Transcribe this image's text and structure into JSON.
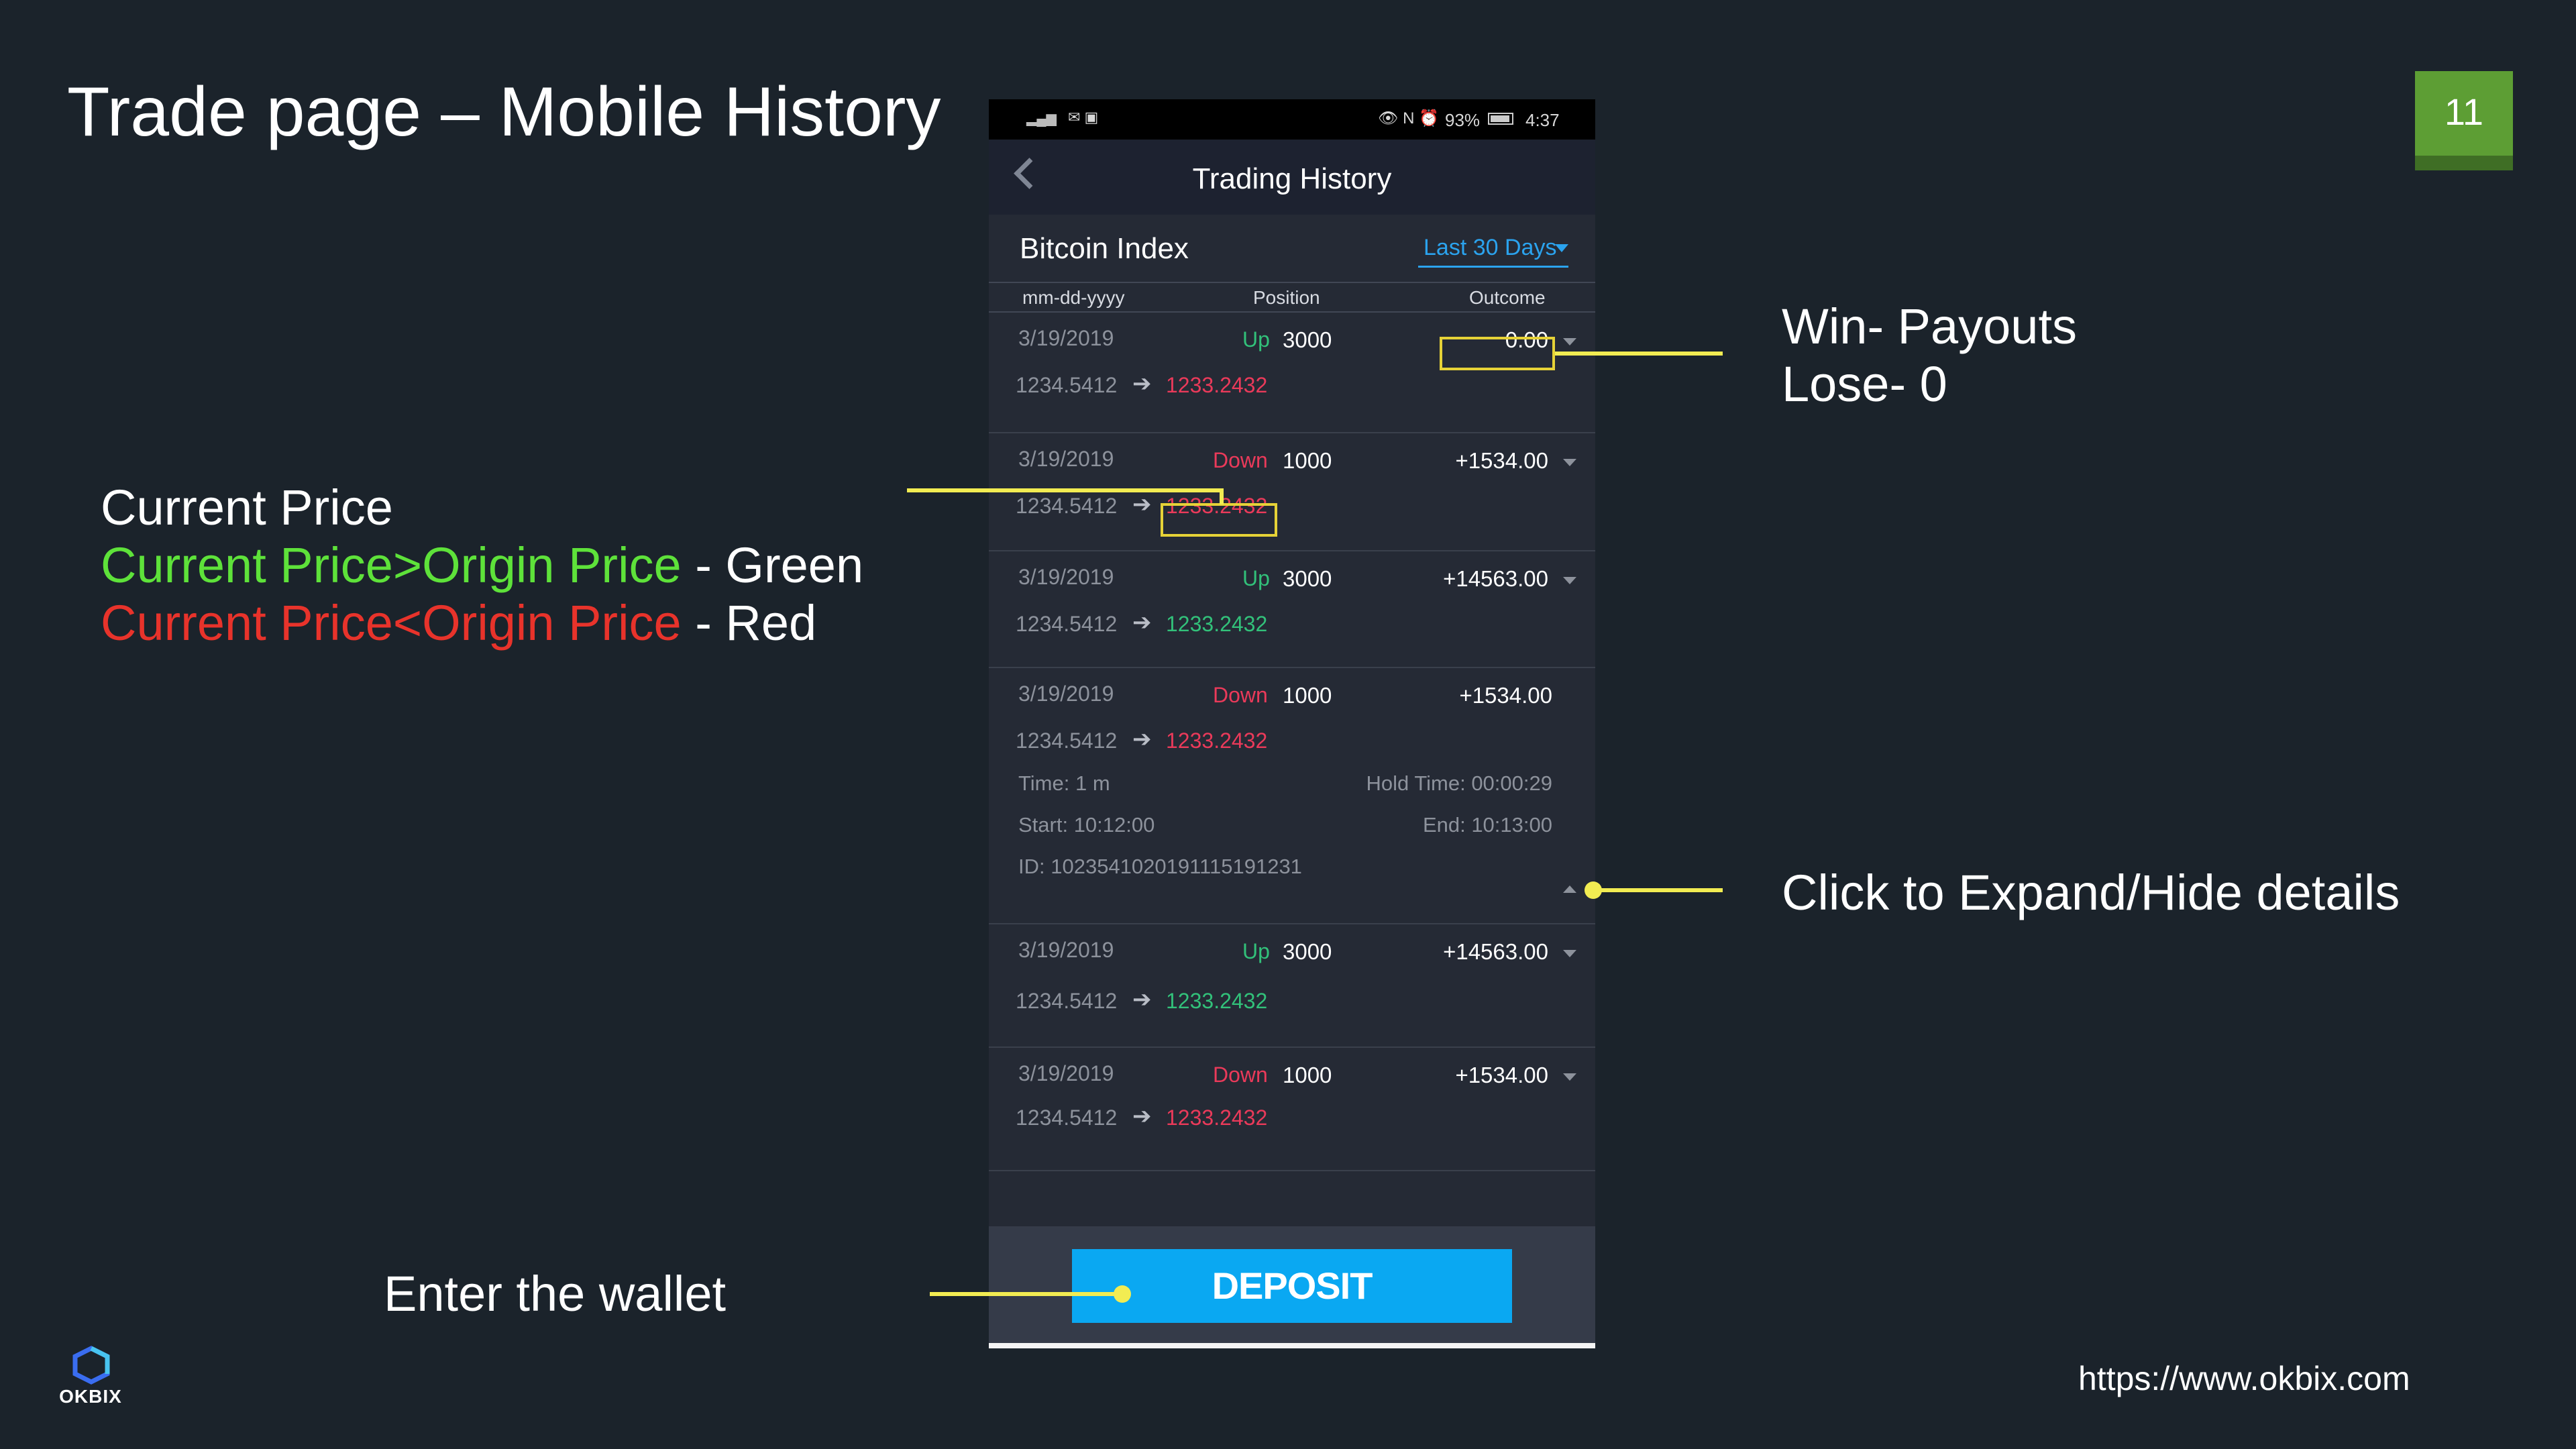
{
  "slide": {
    "title": "Trade page – Mobile History",
    "page_number": "11",
    "footer_url": "https://www.okbix.com",
    "brand": "OKBIX"
  },
  "annotations": {
    "outcome_line1": "Win- Payouts",
    "outcome_line2": "Lose- 0",
    "price_heading": "Current Price",
    "price_green_cond": "Current Price>Origin Price",
    "price_green_suffix": " - Green",
    "price_red_cond": "Current Price<Origin Price",
    "price_red_suffix": " - Red",
    "expand": "Click to Expand/Hide details",
    "wallet": "Enter the wallet",
    "colors": {
      "highlight": "#f2ec52",
      "green": "#5ee23a",
      "red": "#e8332b"
    }
  },
  "phone": {
    "status": {
      "battery": "93%",
      "time": "4:37"
    },
    "nav": {
      "title": "Trading History",
      "back_icon": "chevron-left-icon"
    },
    "filter": {
      "index": "Bitcoin Index",
      "range": "Last 30 Days"
    },
    "columns": {
      "date": "mm-dd-yyyy",
      "position": "Position",
      "outcome": "Outcome"
    },
    "trades": [
      {
        "date": "3/19/2019",
        "direction": "Up",
        "amount": "3000",
        "outcome": "0.00",
        "open": "1234.5412",
        "current": "1233.2432",
        "trend": "red"
      },
      {
        "date": "3/19/2019",
        "direction": "Down",
        "amount": "1000",
        "outcome": "+1534.00",
        "open": "1234.5412",
        "current": "1233.2432",
        "trend": "red"
      },
      {
        "date": "3/19/2019",
        "direction": "Up",
        "amount": "3000",
        "outcome": "+14563.00",
        "open": "1234.5412",
        "current": "1233.2432",
        "trend": "green"
      },
      {
        "date": "3/19/2019",
        "direction": "Down",
        "amount": "1000",
        "outcome": "+1534.00",
        "open": "1234.5412",
        "current": "1233.2432",
        "trend": "red",
        "details": {
          "time": "Time: 1 m",
          "hold": "Hold Time: 00:00:29",
          "start": "Start: 10:12:00",
          "end": "End: 10:13:00",
          "id": "ID: 1023541020191115191231"
        }
      },
      {
        "date": "3/19/2019",
        "direction": "Up",
        "amount": "3000",
        "outcome": "+14563.00",
        "open": "1234.5412",
        "current": "1233.2432",
        "trend": "green"
      },
      {
        "date": "3/19/2019",
        "direction": "Down",
        "amount": "1000",
        "outcome": "+1534.00",
        "open": "1234.5412",
        "current": "1233.2432",
        "trend": "red"
      }
    ],
    "deposit_label": "DEPOSIT"
  }
}
